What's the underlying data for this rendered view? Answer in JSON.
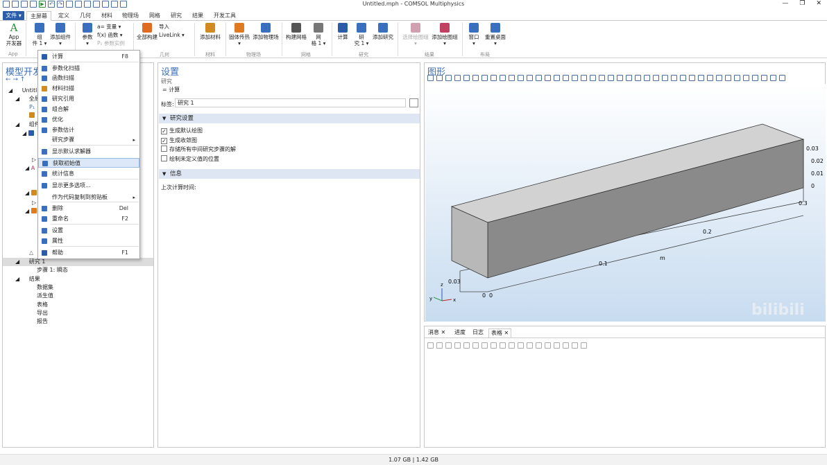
{
  "window": {
    "title": "Untitled.mph - COMSOL Multiphysics",
    "min": "—",
    "max": "❐",
    "close": "✕"
  },
  "tabs": [
    "文件 ▾",
    "主屏幕",
    "定义",
    "几何",
    "材料",
    "物理场",
    "网格",
    "研究",
    "结果",
    "开发工具"
  ],
  "ribbon": {
    "buttons": [
      {
        "label": "App\n开发器",
        "color": "#2a8a3a"
      },
      {
        "label": "组\n件 1 ▾",
        "color": "#3a6fc0"
      },
      {
        "label": "添加组件\n▾",
        "color": "#3a6fc0"
      },
      {
        "label": "参数\n▾",
        "color": "#3a6fc0"
      },
      {
        "label": "全部构建",
        "color": "#e06a20"
      },
      {
        "label": "添加材料",
        "color": "#d08a20"
      },
      {
        "label": "固体传热\n▾",
        "color": "#e07a20"
      },
      {
        "label": "添加物理场",
        "color": "#3a6fc0"
      },
      {
        "label": "构建网格",
        "color": "#555"
      },
      {
        "label": "网\n格 1 ▾",
        "color": "#777"
      },
      {
        "label": "计算",
        "color": "#2a5caa"
      },
      {
        "label": "研\n究 1 ▾",
        "color": "#3a6fc0"
      },
      {
        "label": "添加研究",
        "color": "#3a6fc0"
      },
      {
        "label": "选择绘图组\n▾",
        "color": "#d0a0b0"
      },
      {
        "label": "添加绘图组\n▾",
        "color": "#c04060"
      },
      {
        "label": "窗口\n▾",
        "color": "#3a6fc0"
      },
      {
        "label": "重置桌面\n▾",
        "color": "#3a6fc0"
      }
    ],
    "small": [
      "a= 变量 ▾",
      "f(x) 函数 ▾",
      "P₁ 参数实例",
      "导入",
      "LiveLink ▾"
    ],
    "groups": [
      "App",
      "定义",
      "几何",
      "材料",
      "物理场",
      "网格",
      "研究",
      "结果",
      "布局"
    ]
  },
  "left": {
    "title": "模型开发",
    "tree": [
      {
        "label": "Untitled.mph",
        "color": "#3a6fc0"
      },
      {
        "label": "全局定义",
        "color": "#3a6fc0"
      },
      {
        "label": "P₁",
        "color": "#3a6fc0"
      },
      {
        "label": "",
        "color": "#d08a20"
      },
      {
        "label": "组件 1",
        "color": "#3a6fc0"
      },
      {
        "label": "",
        "color": "#2a5caa"
      },
      {
        "label": "",
        "color": "#777"
      },
      {
        "label": "",
        "color": "#c04060"
      },
      {
        "label": "",
        "color": "#d08a20"
      },
      {
        "label": "",
        "color": "#e07a20"
      },
      {
        "label": "",
        "color": "#666"
      },
      {
        "label": "研究 1",
        "color": "#3a6fc0"
      },
      {
        "label": "步骤 1: 瞬态",
        "color": "#3a6fc0"
      },
      {
        "label": "结果",
        "color": "#c04060"
      },
      {
        "label": "数据集",
        "color": "#c04060"
      },
      {
        "label": "派生值",
        "color": "#c04060"
      },
      {
        "label": "表格",
        "color": "#c04060"
      },
      {
        "label": "导出",
        "color": "#c04060"
      },
      {
        "label": "报告",
        "color": "#c04060"
      }
    ]
  },
  "menu": [
    {
      "label": "计算",
      "key": "F8",
      "color": "#2a5caa"
    },
    {
      "label": "参数化扫描",
      "key": "",
      "color": "#3a6fc0"
    },
    {
      "label": "函数扫描",
      "key": "",
      "color": "#3a6fc0"
    },
    {
      "label": "材料扫描",
      "key": "",
      "color": "#d08a20"
    },
    {
      "label": "研究引用",
      "key": "",
      "color": "#3a6fc0"
    },
    {
      "label": "组合解",
      "key": "",
      "color": "#3a6fc0"
    },
    {
      "label": "优化",
      "key": "",
      "color": "#3a6fc0"
    },
    {
      "label": "参数估计",
      "key": "",
      "color": "#3a6fc0"
    },
    {
      "label": "研究步骤",
      "key": "▸",
      "color": ""
    },
    {
      "label": "显示默认求解器",
      "key": "",
      "color": "#3a6fc0"
    },
    {
      "label": "获取初始值",
      "key": "",
      "color": "#3a6fc0"
    },
    {
      "label": "统计信息",
      "key": "",
      "color": "#3a6fc0"
    },
    {
      "label": "显示更多选项...",
      "key": "",
      "color": "#3a6fc0"
    },
    {
      "label": "作为代码复制到剪贴板",
      "key": "▸",
      "color": ""
    },
    {
      "label": "删除",
      "key": "Del",
      "color": "#3a6fc0"
    },
    {
      "label": "重命名",
      "key": "F2",
      "color": "#3a6fc0"
    },
    {
      "label": "设置",
      "key": "",
      "color": "#3a6fc0"
    },
    {
      "label": "属性",
      "key": "",
      "color": "#3a6fc0"
    },
    {
      "label": "帮助",
      "key": "F1",
      "color": "#2a5caa"
    }
  ],
  "settings": {
    "title": "设置",
    "subtitle": "研究",
    "compute": "= 计算",
    "label_key": "标签:",
    "label_value": "研究 1",
    "sec1": "研究设置",
    "checks": [
      "生成默认绘图",
      "生成收敛图",
      "存储所有中间研究步骤的解",
      "绘制未定义值的位置"
    ],
    "sec2": "信息",
    "last": "上次计算时间:"
  },
  "graphics": {
    "title": "图形",
    "axis_right": [
      "0.03",
      "0.02",
      "0.01",
      "0"
    ],
    "x_ticks": [
      "0.3",
      "0.2",
      "0.1"
    ],
    "unit": "m",
    "left_ticks": [
      "0.03",
      "0"
    ],
    "origin": "0"
  },
  "bottom": {
    "tabs": [
      "消息 ✕",
      "进度",
      "日志",
      "表格 ✕"
    ]
  },
  "status": "1.07 GB | 1.42 GB",
  "watermark": "bilibili"
}
